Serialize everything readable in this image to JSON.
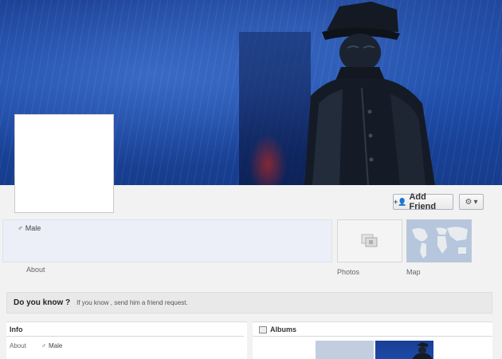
{
  "profile": {
    "gender": "Male"
  },
  "actions": {
    "add_friend_label": "Add Friend"
  },
  "sections": {
    "about_label": "About",
    "photos_label": "Photos",
    "map_label": "Map"
  },
  "know_bar": {
    "title": "Do you know ?",
    "text": "If you know , send him a friend request."
  },
  "info_box": {
    "heading": "Info",
    "about_label": "About",
    "gender": "Male"
  },
  "albums_box": {
    "heading": "Albums"
  },
  "icons": {
    "add_friend": "add-friend-icon",
    "settings": "gear-icon",
    "gender": "male-icon",
    "albums": "album-icon"
  },
  "colors": {
    "cover_blue": "#1c4aa8",
    "info_strip_bg": "#eceff7",
    "bar_bg": "#e9e9e9"
  }
}
